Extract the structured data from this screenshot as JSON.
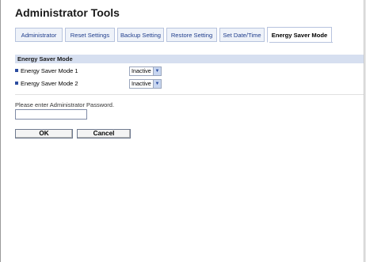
{
  "page": {
    "title": "Administrator Tools"
  },
  "tabs": [
    {
      "label": "Administrator",
      "active": false
    },
    {
      "label": "Reset Settings",
      "active": false
    },
    {
      "label": "Backup Setting",
      "active": false
    },
    {
      "label": "Restore Setting",
      "active": false
    },
    {
      "label": "Set Date/Time",
      "active": false
    },
    {
      "label": "Energy Saver Mode",
      "active": true
    }
  ],
  "section": {
    "heading": "Energy Saver Mode",
    "rows": [
      {
        "label": "Energy Saver Mode 1",
        "value": "Inactive"
      },
      {
        "label": "Energy Saver Mode 2",
        "value": "Inactive"
      }
    ]
  },
  "password": {
    "label": "Please enter Administrator Password.",
    "value": ""
  },
  "buttons": {
    "ok": "OK",
    "cancel": "Cancel"
  },
  "icons": {
    "bullet": "square-bullet-icon",
    "dropdown": "chevron-down-icon"
  },
  "colors": {
    "tab_text": "#1f3d8c",
    "section_bg": "#d6dff0",
    "bullet": "#2b4ca0"
  }
}
